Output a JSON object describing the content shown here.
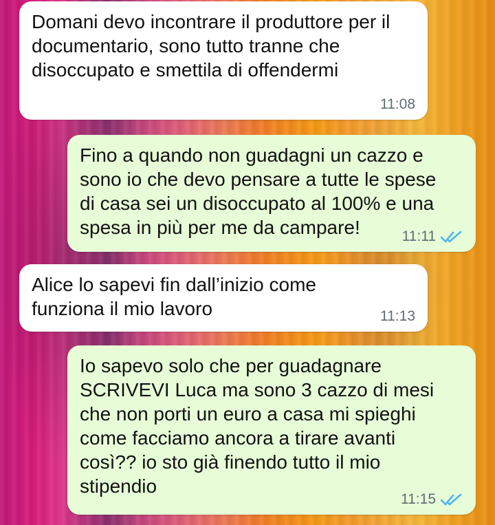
{
  "chat": {
    "messages": [
      {
        "direction": "incoming",
        "text": "Domani devo incontrare il produttore per il\ndocumentario, sono tutto tranne che\ndisoccupato e smettila di offendermi",
        "time": "11:08"
      },
      {
        "direction": "outgoing",
        "text": "Fino a quando non  guadagni un cazzo e\nsono io che devo pensare a tutte le spese\ndi casa sei un disoccupato al 100% e una\nspesa in più per me da campare!",
        "time": "11:11",
        "status_icon": "double-check-read-icon"
      },
      {
        "direction": "incoming",
        "text": "Alice lo sapevi fin dall’inizio come\nfunziona il mio lavoro",
        "time": "11:13"
      },
      {
        "direction": "outgoing",
        "text": "Io sapevo solo che per guadagnare\nSCRIVEVI Luca ma sono 3 cazzo di mesi\nche non porti un euro a casa mi spieghi\ncome facciamo ancora a tirare avanti\ncosì?? io sto già finendo tutto il mio\nstipendio",
        "time": "11:15",
        "status_icon": "double-check-read-icon"
      }
    ]
  },
  "colors": {
    "incoming_bubble": "#ffffff",
    "outgoing_bubble": "#e7fdd8",
    "read_tick": "#4fb6ec",
    "timestamp": "#5f6b73"
  }
}
